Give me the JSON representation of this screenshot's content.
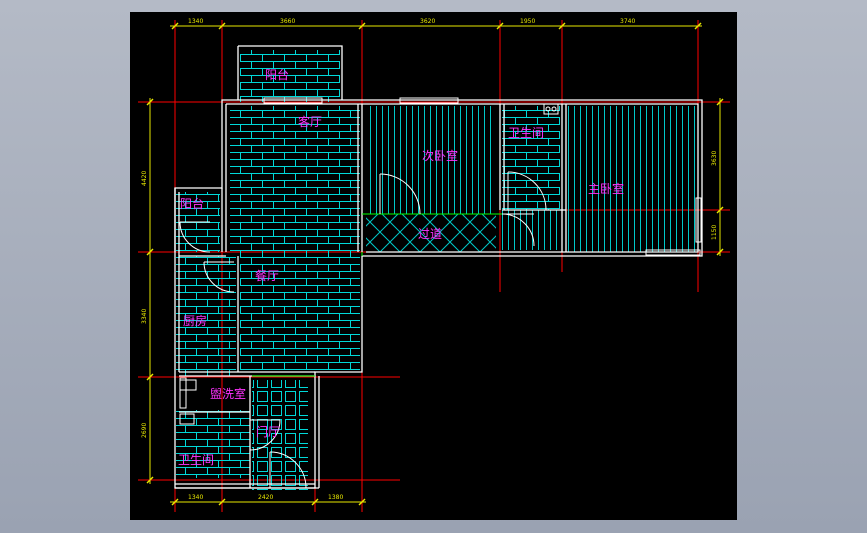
{
  "app": {
    "name": "CAD floor plan viewer",
    "background": "#000000"
  },
  "rooms": {
    "balcony_top": "阳台",
    "living": "客厅",
    "bedroom2": "次卧室",
    "bath_top": "卫生间",
    "master": "主卧室",
    "corridor": "过道",
    "balcony_left": "阳台",
    "dining": "餐厅",
    "kitchen": "厨房",
    "laundry": "盥洗室",
    "foyer": "门厅",
    "bath_bottom": "卫生间"
  },
  "dimensions": {
    "top": [
      "1340",
      "3660",
      "3620",
      "1950",
      "3740"
    ],
    "bottom": [
      "1340",
      "2420",
      "1380"
    ],
    "left": [
      "4420",
      "3340",
      "2690"
    ],
    "right": [
      "3630",
      "1150"
    ]
  },
  "colors": {
    "wall": "#ffffff",
    "tile": "#00e0e0",
    "axis": "#ff0000",
    "dimension": "#e8e800",
    "label": "#ff33ff",
    "door": "#ffffff",
    "window": "#00ff00"
  }
}
